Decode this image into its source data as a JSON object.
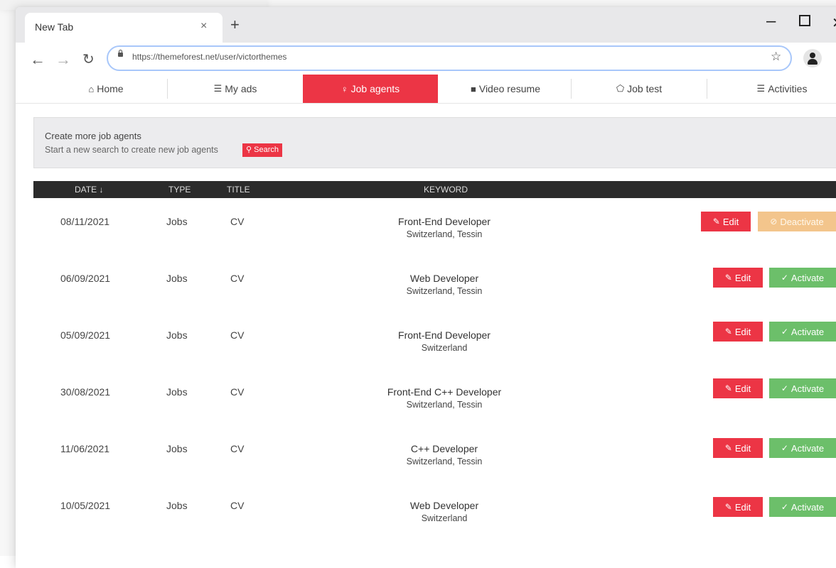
{
  "browser": {
    "tab_title": "New Tab",
    "tab_close": "×",
    "new_tab": "+",
    "url": "https://themeforest.net/user/victorthemes",
    "icons": {
      "back": "arrow-left-icon",
      "forward": "arrow-right-icon",
      "reload": "reload-icon",
      "lock": "lock-icon",
      "star": "star-icon",
      "profile": "profile-icon",
      "menu": "kebab-menu-icon"
    }
  },
  "nav": {
    "items": [
      {
        "label": "Home",
        "icon": "home-icon",
        "glyph": "🏠"
      },
      {
        "label": "My ads",
        "icon": "list-icon",
        "glyph": "☰"
      },
      {
        "label": "Job agents",
        "icon": "bulb-icon",
        "glyph": "💡"
      },
      {
        "label": "Video resume",
        "icon": "video-icon",
        "glyph": "■◂"
      },
      {
        "label": "Job test",
        "icon": "pentagon-icon",
        "glyph": "⬠"
      },
      {
        "label": "Activities",
        "icon": "list-icon",
        "glyph": "☰"
      }
    ],
    "active_index": 2,
    "active_color": "#ec3545"
  },
  "promo": {
    "title": "Create more job agents",
    "subtitle": "Start a new search to create new job agents",
    "search_label": "Search"
  },
  "table": {
    "headers": {
      "date": "DATE ↓",
      "type": "TYPE",
      "title": "TITLE",
      "keyword": "KEYWORD"
    },
    "edit_label": "Edit",
    "activate_label": "Activate",
    "deactivate_label": "Deactivate",
    "rows": [
      {
        "date": "08/11/2021",
        "type": "Jobs",
        "title": "CV",
        "keyword": "Front-End Developer",
        "location": "Switzerland, Tessin",
        "action": "Deactivate"
      },
      {
        "date": "06/09/2021",
        "type": "Jobs",
        "title": "CV",
        "keyword": "Web Developer",
        "location": "Switzerland, Tessin",
        "action": "Activate"
      },
      {
        "date": "05/09/2021",
        "type": "Jobs",
        "title": "CV",
        "keyword": "Front-End Developer",
        "location": "Switzerland",
        "action": "Activate"
      },
      {
        "date": "30/08/2021",
        "type": "Jobs",
        "title": "CV",
        "keyword": "Front-End C++ Developer",
        "location": "Switzerland, Tessin",
        "action": "Activate"
      },
      {
        "date": "11/06/2021",
        "type": "Jobs",
        "title": "CV",
        "keyword": "C++ Developer",
        "location": "Switzerland, Tessin",
        "action": "Activate"
      },
      {
        "date": "10/05/2021",
        "type": "Jobs",
        "title": "CV",
        "keyword": "Web Developer",
        "location": "Switzerland",
        "action": "Activate"
      }
    ]
  }
}
